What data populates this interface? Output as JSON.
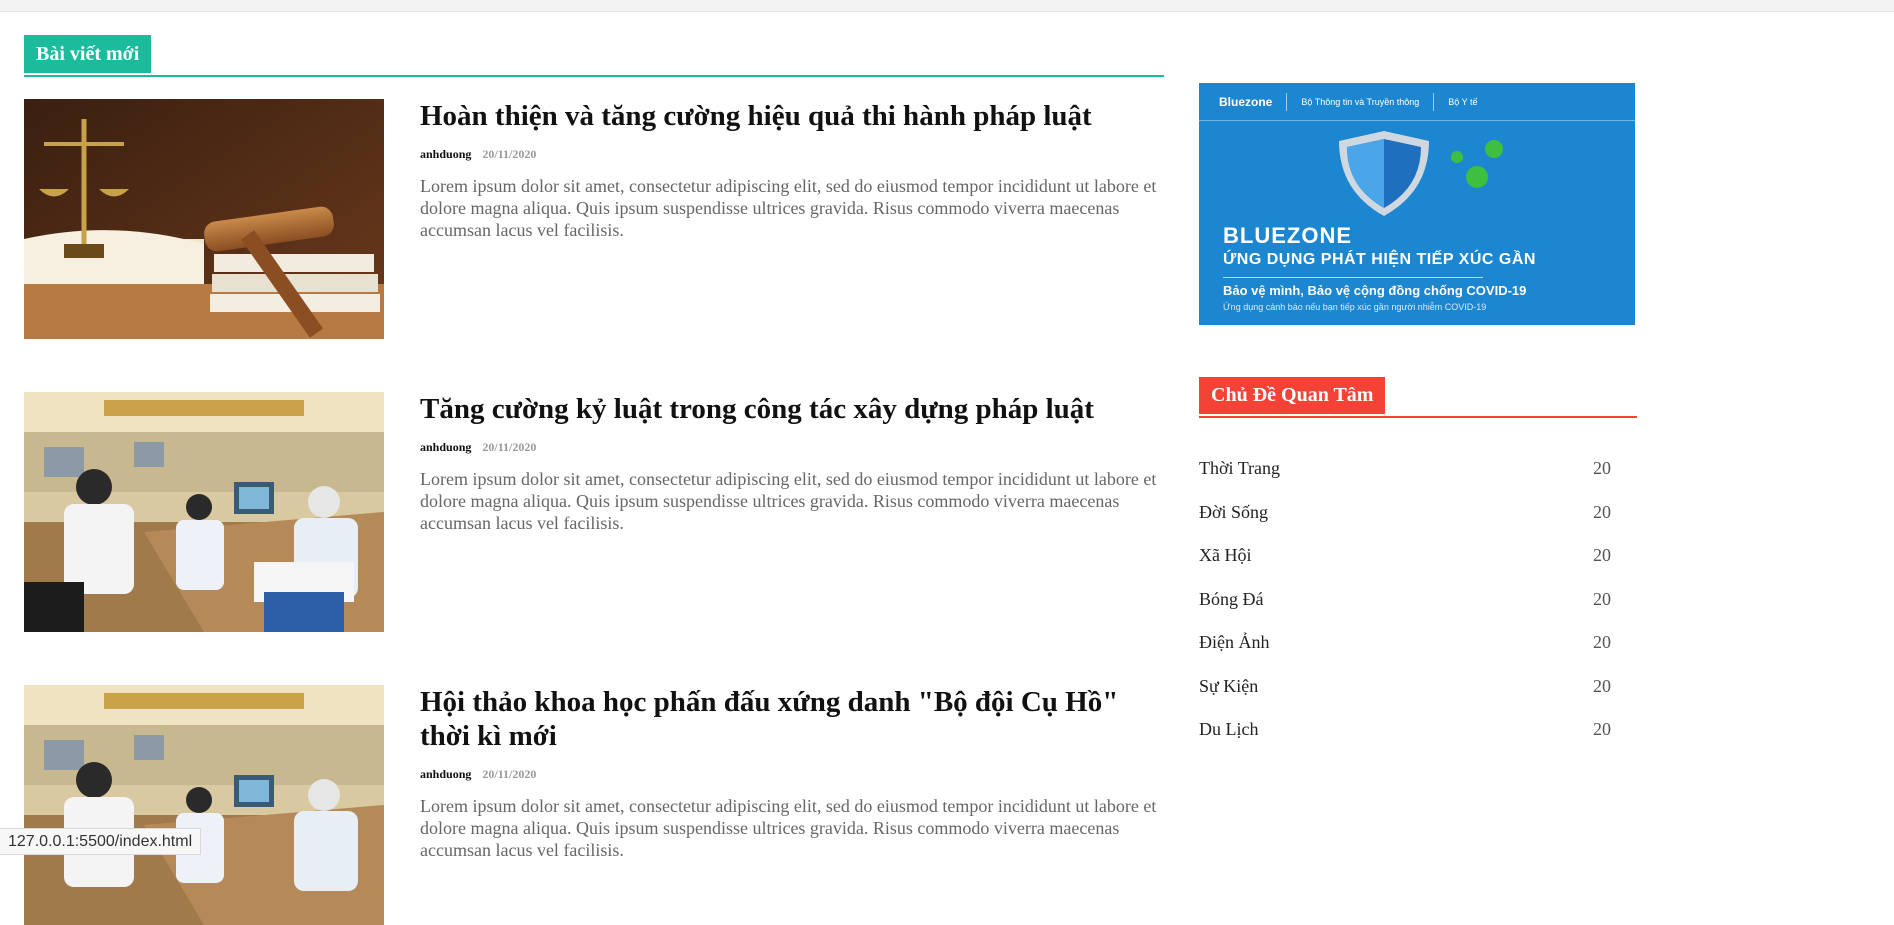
{
  "section": {
    "title": "Bài viết mới"
  },
  "posts": [
    {
      "title": "Hoàn thiện và tăng cường hiệu quả thi hành pháp luật",
      "author": "anhduong",
      "date": "20/11/2020",
      "excerpt": "Lorem ipsum dolor sit amet, consectetur adipiscing elit, sed do eiusmod tempor incididunt ut labore et dolore magna aliqua. Quis ipsum suspendisse ultrices gravida. Risus commodo viverra maecenas accumsan lacus vel facilisis.",
      "image": "gavel-scales-image"
    },
    {
      "title": "Tăng cường kỷ luật trong công tác xây dựng pháp luật",
      "author": "anhduong",
      "date": "20/11/2020",
      "excerpt": "Lorem ipsum dolor sit amet, consectetur adipiscing elit, sed do eiusmod tempor incididunt ut labore et dolore magna aliqua. Quis ipsum suspendisse ultrices gravida. Risus commodo viverra maecenas accumsan lacus vel facilisis.",
      "image": "office-workers-image"
    },
    {
      "title": "Hội thảo khoa học phấn đấu xứng danh \"Bộ đội Cụ Hồ\" thời kì mới",
      "author": "anhduong",
      "date": "20/11/2020",
      "excerpt": "Lorem ipsum dolor sit amet, consectetur adipiscing elit, sed do eiusmod tempor incididunt ut labore et dolore magna aliqua. Quis ipsum suspendisse ultrices gravida. Risus commodo viverra maecenas accumsan lacus vel facilisis.",
      "image": "office-workers-image"
    }
  ],
  "banner": {
    "brand": "Bluezone",
    "partner1": "Bộ Thông tin và Truyền thông",
    "partner2": "Bộ Y tế",
    "title": "BLUEZONE",
    "subtitle": "ỨNG DỤNG PHÁT HIỆN TIẾP XÚC GẦN",
    "slogan": "Bảo vệ mình, Bảo vệ cộng đồng chống COVID-19",
    "note": "Ứng dụng cảnh báo nếu bạn tiếp xúc gần người nhiễm COVID-19",
    "color": "#1d86d1"
  },
  "topics": {
    "title": "Chủ Đề Quan Tâm",
    "items": [
      {
        "label": "Thời Trang",
        "count": "20"
      },
      {
        "label": "Đời Sống",
        "count": "20"
      },
      {
        "label": "Xã Hội",
        "count": "20"
      },
      {
        "label": "Bóng Đá",
        "count": "20"
      },
      {
        "label": "Điện Ảnh",
        "count": "20"
      },
      {
        "label": "Sự Kiện",
        "count": "20"
      },
      {
        "label": "Du Lịch",
        "count": "20"
      }
    ]
  },
  "statusbar": {
    "url": "127.0.0.1:5500/index.html"
  },
  "colors": {
    "accent_green": "#1abc9c",
    "accent_red": "#f44336"
  }
}
